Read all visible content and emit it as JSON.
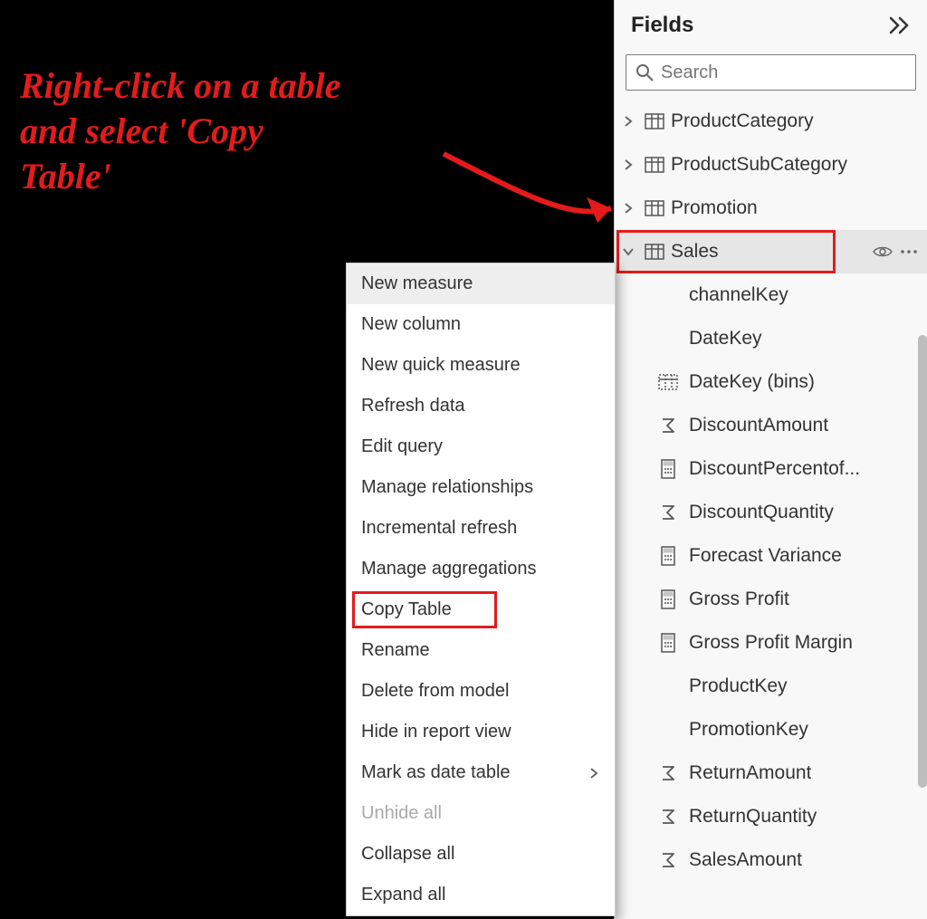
{
  "annotation": {
    "line1": "Right-click on a table",
    "line2": "and select 'Copy",
    "line3": "Table'"
  },
  "fields_panel": {
    "title": "Fields",
    "search_placeholder": "Search",
    "tables": [
      {
        "name": "ProductCategory",
        "expanded": false
      },
      {
        "name": "ProductSubCategory",
        "expanded": false
      },
      {
        "name": "Promotion",
        "expanded": false
      },
      {
        "name": "Sales",
        "expanded": true,
        "selected": true,
        "highlighted": true
      }
    ],
    "sales_fields": [
      {
        "label": "channelKey",
        "icon": "none"
      },
      {
        "label": "DateKey",
        "icon": "none"
      },
      {
        "label": "DateKey (bins)",
        "icon": "bin"
      },
      {
        "label": "DiscountAmount",
        "icon": "sigma"
      },
      {
        "label": "DiscountPercentof...",
        "icon": "calc"
      },
      {
        "label": "DiscountQuantity",
        "icon": "sigma"
      },
      {
        "label": "Forecast Variance",
        "icon": "calc"
      },
      {
        "label": "Gross Profit",
        "icon": "calc"
      },
      {
        "label": "Gross Profit Margin",
        "icon": "calc"
      },
      {
        "label": "ProductKey",
        "icon": "none"
      },
      {
        "label": "PromotionKey",
        "icon": "none"
      },
      {
        "label": "ReturnAmount",
        "icon": "sigma"
      },
      {
        "label": "ReturnQuantity",
        "icon": "sigma"
      },
      {
        "label": "SalesAmount",
        "icon": "sigma"
      }
    ]
  },
  "context_menu": {
    "items": [
      {
        "label": "New measure",
        "hover": true
      },
      {
        "label": "New column"
      },
      {
        "label": "New quick measure"
      },
      {
        "label": "Refresh data"
      },
      {
        "label": "Edit query"
      },
      {
        "label": "Manage relationships"
      },
      {
        "label": "Incremental refresh"
      },
      {
        "label": "Manage aggregations"
      },
      {
        "label": "Copy Table",
        "highlighted": true
      },
      {
        "label": "Rename"
      },
      {
        "label": "Delete from model"
      },
      {
        "label": "Hide in report view"
      },
      {
        "label": "Mark as date table",
        "submenu": true
      },
      {
        "label": "Unhide all",
        "disabled": true
      },
      {
        "label": "Collapse all"
      },
      {
        "label": "Expand all"
      }
    ]
  }
}
